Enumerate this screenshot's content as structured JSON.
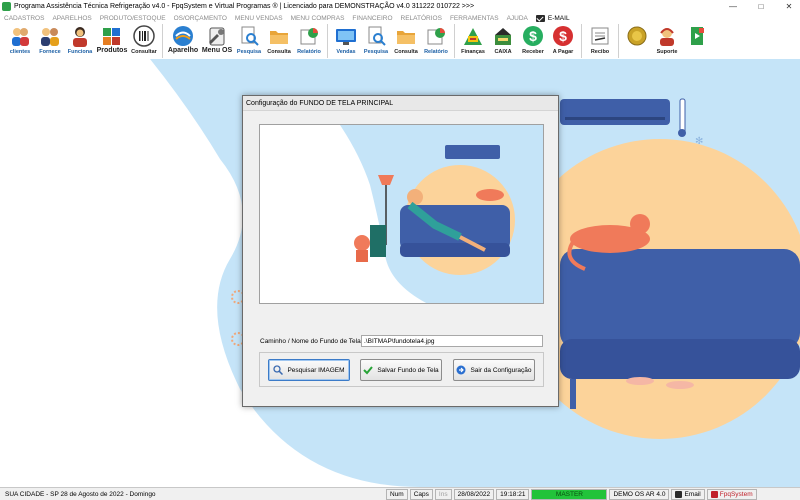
{
  "window": {
    "title": "Programa Assistência Técnica Refrigeração v4.0 - FpqSystem e Virtual Programas ® | Licenciado para  DEMONSTRAÇÃO v4.0 311222 010722 >>>",
    "minimize": "—",
    "maximize": "□",
    "close": "✕"
  },
  "menu": {
    "items": [
      "CADASTROS",
      "APARELHOS",
      "PRODUTO/ESTOQUE",
      "OS/ORÇAMENTO",
      "MENU VENDAS",
      "MENU COMPRAS",
      "FINANCEIRO",
      "RELATÓRIOS",
      "FERRAMENTAS",
      "AJUDA"
    ],
    "email": "E-MAIL"
  },
  "toolbar": {
    "clientes": "clientes",
    "fornece": "Fornece",
    "funciona": "Funciona",
    "produtos": "Produtos",
    "consultar": "Consultar",
    "aparelho": "Aparelho",
    "menu_os": "Menu OS",
    "pesquisa1": "Pesquisa",
    "consulta1": "Consulta",
    "relatorio1": "Relatório",
    "vendas": "Vendas",
    "pesquisa2": "Pesquisa",
    "consulta2": "Consulta",
    "relatorio2": "Relatório",
    "financas": "Finanças",
    "caixa": "CAIXA",
    "receber": "Receber",
    "apagar": "A Pagar",
    "recibo": "Recibo",
    "suporte": "Suporte"
  },
  "dialog": {
    "title": "Configuração do FUNDO DE TELA PRINCIPAL",
    "path_label": "Caminho / Nome do Fundo de Tela",
    "path_value": ".\\BITMAP\\fundotela4.jpg",
    "btn_search": "Pesquisar IMAGEM",
    "btn_save": "Salvar Fundo de Tela",
    "btn_exit": "Sair da Configuração"
  },
  "status": {
    "city": "SUA CIDADE - SP 28 de Agosto de 2022 - Domingo",
    "num": "Num",
    "caps": "Caps",
    "ins": "Ins",
    "date": "28/08/2022",
    "time": "19:18:21",
    "master": "MASTER",
    "demo": "DEMO OS AR 4.0",
    "email": "Email",
    "fpq": "FpqSystem"
  },
  "colors": {
    "sky": "#c5e4f8",
    "sofa": "#3f5fa8",
    "sun": "#fcd39a",
    "cat": "#f07a5a",
    "master_green": "#22c33a"
  }
}
